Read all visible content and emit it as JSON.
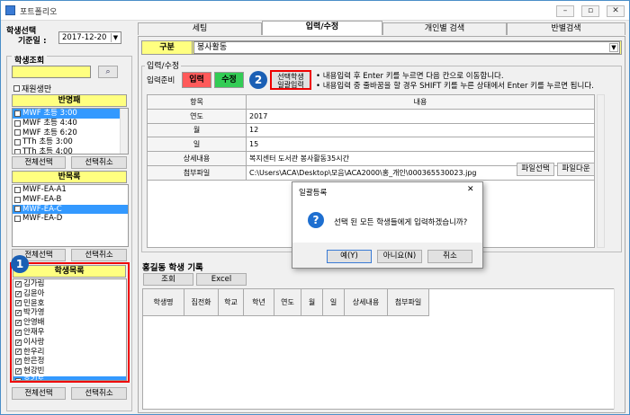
{
  "window": {
    "title": "포트폴리오",
    "min": "–",
    "max": "▫",
    "close": "✕"
  },
  "left": {
    "student_select_title": "학생선택",
    "base_date_label": "기준일 :",
    "base_date_value": "2017-12-20",
    "student_search_title": "학생조회",
    "enrolled_only_label": "재원생만",
    "class_list_title": "반명패",
    "class_items": [
      {
        "label": "MWF 초등 3:00",
        "checked": true,
        "selected": true
      },
      {
        "label": "MWF 초등 4:40",
        "checked": false,
        "selected": false
      },
      {
        "label": "MWF 초등 6:20",
        "checked": false,
        "selected": false
      },
      {
        "label": "TTh 초등 3:00",
        "checked": false,
        "selected": false
      },
      {
        "label": "TTh 초등 4:00",
        "checked": false,
        "selected": false
      }
    ],
    "select_all": "전체선택",
    "deselect": "선택취소",
    "class_group_title": "반목록",
    "group_items": [
      {
        "label": "MWF-EA-A1",
        "checked": false,
        "selected": false
      },
      {
        "label": "MWF-EA-B",
        "checked": false,
        "selected": false
      },
      {
        "label": "MWF-EA-C",
        "checked": true,
        "selected": true
      },
      {
        "label": "MWF-EA-D",
        "checked": false,
        "selected": false
      }
    ],
    "student_list_title": "학생목록",
    "students": [
      {
        "label": "김가림",
        "checked": true,
        "selected": false
      },
      {
        "label": "김윤아",
        "checked": true,
        "selected": false
      },
      {
        "label": "민윤호",
        "checked": true,
        "selected": false
      },
      {
        "label": "박가영",
        "checked": true,
        "selected": false
      },
      {
        "label": "안영배",
        "checked": true,
        "selected": false
      },
      {
        "label": "안재우",
        "checked": true,
        "selected": false
      },
      {
        "label": "이사랑",
        "checked": true,
        "selected": false
      },
      {
        "label": "한우리",
        "checked": true,
        "selected": false
      },
      {
        "label": "한은정",
        "checked": true,
        "selected": false
      },
      {
        "label": "현강빈",
        "checked": true,
        "selected": false
      },
      {
        "label": "홍길동",
        "checked": true,
        "selected": true
      }
    ],
    "badge1": "1"
  },
  "tabs": [
    "세팅",
    "입력/수정",
    "개인별 검색",
    "반별검색"
  ],
  "category": {
    "label": "구분",
    "value": "봉사활동"
  },
  "input_section": {
    "title": "입력/수정",
    "prepare_label": "입력준비",
    "input_btn": "입력",
    "edit_btn": "수정",
    "badge2": "2",
    "bulk_btn_line1": "선택학생",
    "bulk_btn_line2": "일괄입력",
    "note1": "• 내용입력 후  Enter 키를 누르면 다음 칸으로 이동합니다.",
    "note2": "• 내용입력 중 줄바꿈을 할 경우 SHIFT 키를 누른  상태에서 Enter 키를 누르면 됩니다."
  },
  "form_table": {
    "col_item": "항목",
    "col_content": "내용",
    "rows": [
      {
        "label": "연도",
        "value": "2017"
      },
      {
        "label": "월",
        "value": "12"
      },
      {
        "label": "일",
        "value": "15"
      },
      {
        "label": "상세내용",
        "value": "복지센터 도서관 봉사활동35시간"
      },
      {
        "label": "첨부파일",
        "value": "C:\\Users\\ACA\\Desktop\\모음\\ACA2000\\홍_개인\\000365530023.jpg"
      }
    ],
    "file_select": "파일선택",
    "file_download": "파일다운"
  },
  "record": {
    "title": "홍길동 학생 기록",
    "query_btn": "조회",
    "excel_btn": "Excel",
    "columns": [
      "학생명",
      "집전화",
      "학교",
      "학년",
      "연도",
      "월",
      "일",
      "상세내용",
      "첨부파일"
    ]
  },
  "dialog": {
    "title": "일괄등록",
    "message": "선택 된 모든 학생들에게  입력하겠습니까?",
    "yes": "예(Y)",
    "no": "아니요(N)",
    "cancel": "취소",
    "close": "✕"
  }
}
